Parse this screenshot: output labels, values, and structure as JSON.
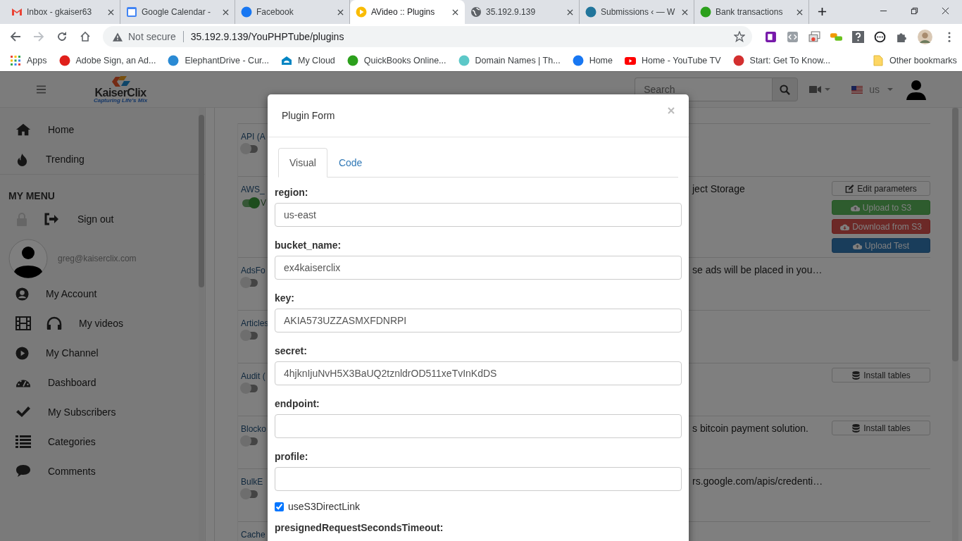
{
  "browser": {
    "tabs": [
      {
        "title": "Inbox - gkaiser63",
        "selected": false
      },
      {
        "title": "Google Calendar -",
        "selected": false
      },
      {
        "title": "Facebook",
        "selected": false
      },
      {
        "title": "AVideo :: Plugins",
        "selected": true
      },
      {
        "title": "35.192.9.139",
        "selected": false
      },
      {
        "title": "Submissions ‹ — W",
        "selected": false
      },
      {
        "title": "Bank transactions",
        "selected": false
      }
    ],
    "address": {
      "security": "Not secure",
      "url": "35.192.9.139/YouPHPTube/plugins"
    },
    "bookmarks": [
      {
        "label": "Apps"
      },
      {
        "label": "Adobe Sign, an Ad..."
      },
      {
        "label": "ElephantDrive - Cur..."
      },
      {
        "label": "My Cloud"
      },
      {
        "label": "QuickBooks Online..."
      },
      {
        "label": "Domain Names | Th..."
      },
      {
        "label": "Home"
      },
      {
        "label": "Home - YouTube TV"
      },
      {
        "label": "Start: Get To Know..."
      }
    ],
    "other_bookmarks": "Other bookmarks"
  },
  "site": {
    "logo": {
      "name": "KaiserClix",
      "tagline": "Capturing Life's Mix"
    },
    "search": {
      "placeholder": "Search"
    },
    "language": "us",
    "sidebar": [
      {
        "kind": "link",
        "label": "Home"
      },
      {
        "kind": "link",
        "label": "Trending"
      },
      {
        "kind": "heading",
        "label": "MY MENU"
      },
      {
        "kind": "signout",
        "label": "Sign out"
      },
      {
        "kind": "user",
        "label": "greg@kaiserclix.com"
      },
      {
        "kind": "link",
        "label": "My Account"
      },
      {
        "kind": "link",
        "label": "My videos"
      },
      {
        "kind": "link",
        "label": "My Channel"
      },
      {
        "kind": "link",
        "label": "Dashboard"
      },
      {
        "kind": "link",
        "label": "My Subscribers"
      },
      {
        "kind": "link",
        "label": "Categories"
      },
      {
        "kind": "link",
        "label": "Comments"
      }
    ],
    "plugins": [
      {
        "name": "API (A",
        "on": false
      },
      {
        "name": "AWS_",
        "on": true,
        "note": "V",
        "description": "ject Storage",
        "buttons": [
          {
            "label": "Edit parameters",
            "kind": "default"
          },
          {
            "label": "Upload to S3",
            "kind": "success"
          },
          {
            "label": "Download from S3",
            "kind": "danger"
          },
          {
            "label": "Upload Test",
            "kind": "primary"
          }
        ]
      },
      {
        "name": "AdsFo",
        "on": false,
        "description": "se ads will be placed in you…"
      },
      {
        "name": "Articles",
        "on": false
      },
      {
        "name": "Audit (",
        "on": false,
        "buttons": [
          {
            "label": "Install tables",
            "kind": "default"
          }
        ]
      },
      {
        "name": "Blocko",
        "on": false,
        "description": "s bitcoin payment solution.",
        "buttons": [
          {
            "label": "Install tables",
            "kind": "default"
          }
        ]
      },
      {
        "name": "BulkE",
        "on": false,
        "description": "rs.google.com/apis/credenti…"
      },
      {
        "name": "Cache"
      }
    ]
  },
  "modal": {
    "title": "Plugin Form",
    "tabs": [
      {
        "label": "Visual",
        "selected": true
      },
      {
        "label": "Code",
        "selected": false
      }
    ],
    "fields": [
      {
        "kind": "text",
        "label": "region:",
        "value": "us-east"
      },
      {
        "kind": "text",
        "label": "bucket_name:",
        "value": "ex4kaiserclix"
      },
      {
        "kind": "text",
        "label": "key:",
        "value": "AKIA573UZZASMXFDNRPI"
      },
      {
        "kind": "text",
        "label": "secret:",
        "value": "4hjknIjuNvH5X3BaUQ2tznldrOD511xeTvInKdDS"
      },
      {
        "kind": "text",
        "label": "endpoint:"
      },
      {
        "kind": "text",
        "label": "profile:"
      },
      {
        "kind": "checkbox",
        "label": "useS3DirectLink",
        "checked": true
      },
      {
        "kind": "label",
        "label": "presignedRequestSecondsTimeout:"
      }
    ]
  }
}
